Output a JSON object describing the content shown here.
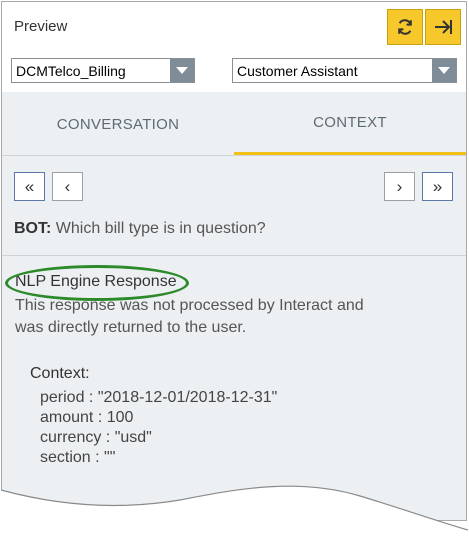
{
  "header": {
    "title": "Preview",
    "refresh_icon": "refresh-icon",
    "collapse_icon": "arrow-right-icon",
    "accent_color": "#f7c82c"
  },
  "selects": {
    "workspace": "DCMTelco_Billing",
    "assistant": "Customer Assistant"
  },
  "tabs": [
    {
      "label": "CONVERSATION",
      "active": false
    },
    {
      "label": "CONTEXT",
      "active": true
    }
  ],
  "nav": {
    "first": "«",
    "prev": "‹",
    "next": "›",
    "last": "»"
  },
  "bot": {
    "speaker": "BOT:",
    "message": "Which bill type is in question?"
  },
  "nlp": {
    "title": "NLP Engine Response",
    "description": "This response was not processed by Interact and was directly returned to the user."
  },
  "context": {
    "label": "Context:",
    "entries": [
      "period : \"2018-12-01/2018-12-31\"",
      "amount : 100",
      "currency : \"usd\"",
      "section : \"\""
    ]
  }
}
